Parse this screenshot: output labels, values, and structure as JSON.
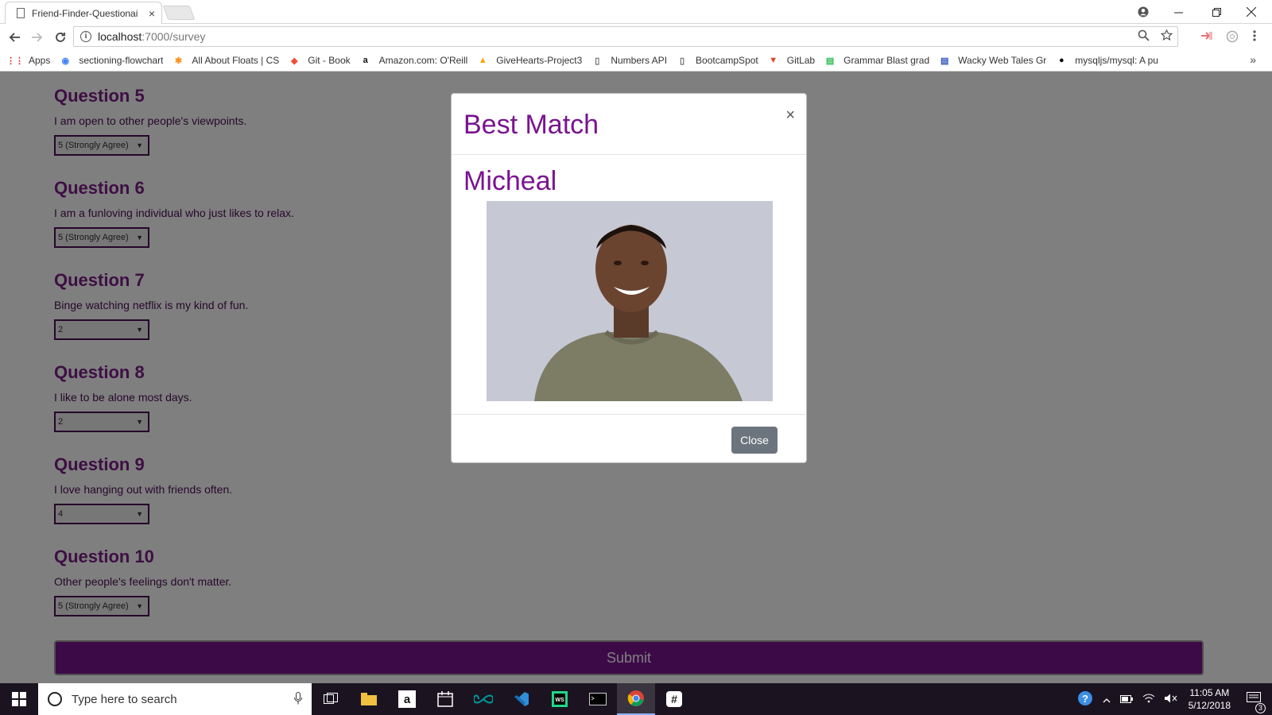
{
  "browser": {
    "tab_title": "Friend-Finder-Questionai",
    "tab_close": "×",
    "url_host": "localhost",
    "url_path": ":7000/survey",
    "bookmarks": [
      {
        "label": "Apps",
        "icon": "apps-grid-icon",
        "color": "#d33"
      },
      {
        "label": "sectioning-flowchart",
        "icon": "flowchart-icon",
        "color": "#4285f4"
      },
      {
        "label": "All About Floats | CS",
        "icon": "asterisk-icon",
        "color": "#f7931e"
      },
      {
        "label": "Git - Book",
        "icon": "git-icon",
        "color": "#f05033"
      },
      {
        "label": "Amazon.com: O'Reill",
        "icon": "amazon-icon",
        "color": "#111"
      },
      {
        "label": "GiveHearts-Project3",
        "icon": "firebase-icon",
        "color": "#ffa000"
      },
      {
        "label": "Numbers API",
        "icon": "page-icon",
        "color": "#666"
      },
      {
        "label": "BootcampSpot",
        "icon": "page-icon",
        "color": "#666"
      },
      {
        "label": "GitLab",
        "icon": "gitlab-icon",
        "color": "#e24329"
      },
      {
        "label": "Grammar Blast grad",
        "icon": "site-icon",
        "color": "#3b5"
      },
      {
        "label": "Wacky Web Tales Gr",
        "icon": "site-icon",
        "color": "#35b"
      },
      {
        "label": "mysqljs/mysql: A pu",
        "icon": "github-icon",
        "color": "#111"
      }
    ],
    "bookmarks_more": "»"
  },
  "survey": {
    "questions": [
      {
        "title": "Question 5",
        "text": "I am open to other people's viewpoints.",
        "value": "5 (Strongly Agree)"
      },
      {
        "title": "Question 6",
        "text": "I am a funloving individual who just likes to relax.",
        "value": "5 (Strongly Agree)"
      },
      {
        "title": "Question 7",
        "text": "Binge watching netflix is my kind of fun.",
        "value": "2"
      },
      {
        "title": "Question 8",
        "text": "I like to be alone most days.",
        "value": "2"
      },
      {
        "title": "Question 9",
        "text": "I love hanging out with friends often.",
        "value": "4"
      },
      {
        "title": "Question 10",
        "text": "Other people's feelings don't matter.",
        "value": "5 (Strongly Agree)"
      }
    ],
    "submit_label": "Submit",
    "accent": "#7a1490"
  },
  "modal": {
    "title": "Best Match",
    "close_x": "×",
    "match_name": "Micheal",
    "close_label": "Close"
  },
  "taskbar": {
    "search_placeholder": "Type here to search",
    "time": "11:05 AM",
    "date": "5/12/2018",
    "notification_count": "3"
  }
}
